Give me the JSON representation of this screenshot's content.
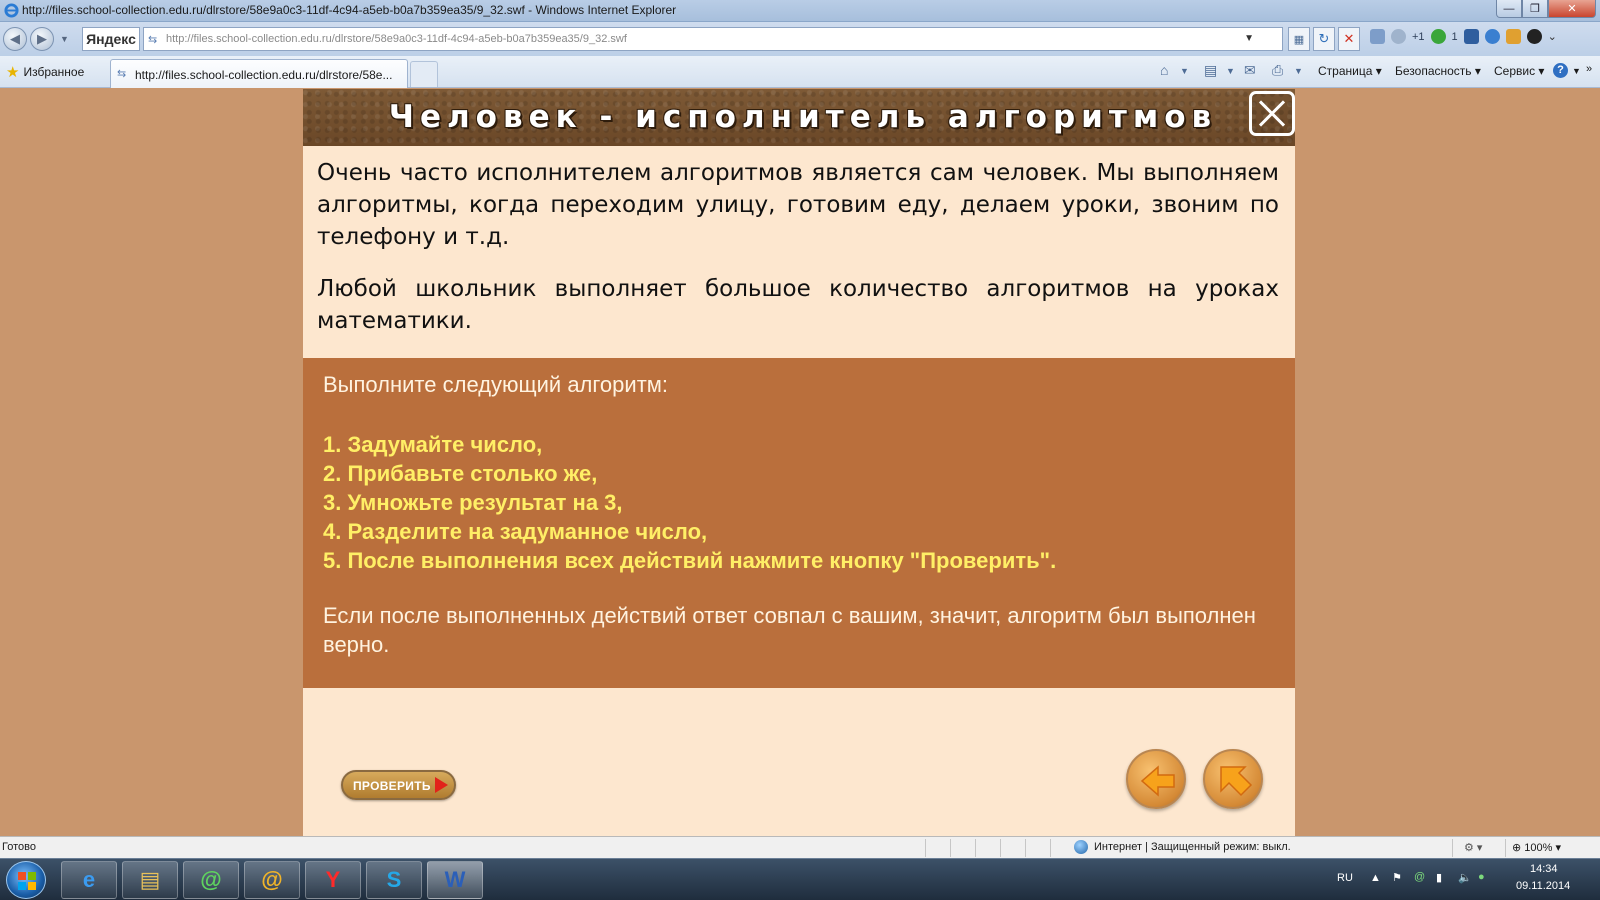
{
  "window": {
    "title": "http://files.school-collection.edu.ru/dlrstore/58e9a0c3-11df-4c94-a5eb-b0a7b359ea35/9_32.swf - Windows Internet Explorer"
  },
  "addressbar": {
    "search_provider": "Яндекс",
    "url": "http://files.school-collection.edu.ru/dlrstore/58e9a0c3-11df-4c94-a5eb-b0a7b359ea35/9_32.swf",
    "ext_badge_1": "+1",
    "ext_badge_2": "1"
  },
  "favbar": {
    "favorites_label": "Избранное",
    "tab_label": "http://files.school-collection.edu.ru/dlrstore/58e...",
    "commands": {
      "page": "Страница",
      "safety": "Безопасность",
      "tools": "Сервис"
    }
  },
  "lesson": {
    "title": "Человек - исполнитель алгоритмов",
    "intro_paragraphs": [
      "Очень часто исполнителем алгоритмов является сам человек. Мы выполняем алгоритмы, когда переходим улицу, готовим еду, делаем уроки, звоним по телефону и т.д.",
      "Любой школьник выполняет большое количество алгоритмов на уроках математики."
    ],
    "task_heading": "Выполните следующий алгоритм:",
    "steps": [
      "1. Задумайте число,",
      "2. Прибавьте столько же,",
      "3. Умножьте результат на 3,",
      "4. Разделите на задуманное число,",
      "5. После выполнения всех действий нажмите кнопку \"Проверить\"."
    ],
    "task_note": "Если после выполненных действий ответ совпал с вашим, значит, алгоритм был выполнен верно.",
    "check_button": "ПРОВЕРИТЬ"
  },
  "statusbar": {
    "status": "Готово",
    "zone": "Интернет | Защищенный режим: выкл.",
    "zoom": "100%"
  },
  "taskbar": {
    "language": "RU",
    "time": "14:34",
    "date": "09.11.2014"
  },
  "colors": {
    "page_background": "#c9966d",
    "panel_background": "#fde7cf",
    "task_background": "#ba6f3c",
    "steps_text": "#ffef66"
  }
}
